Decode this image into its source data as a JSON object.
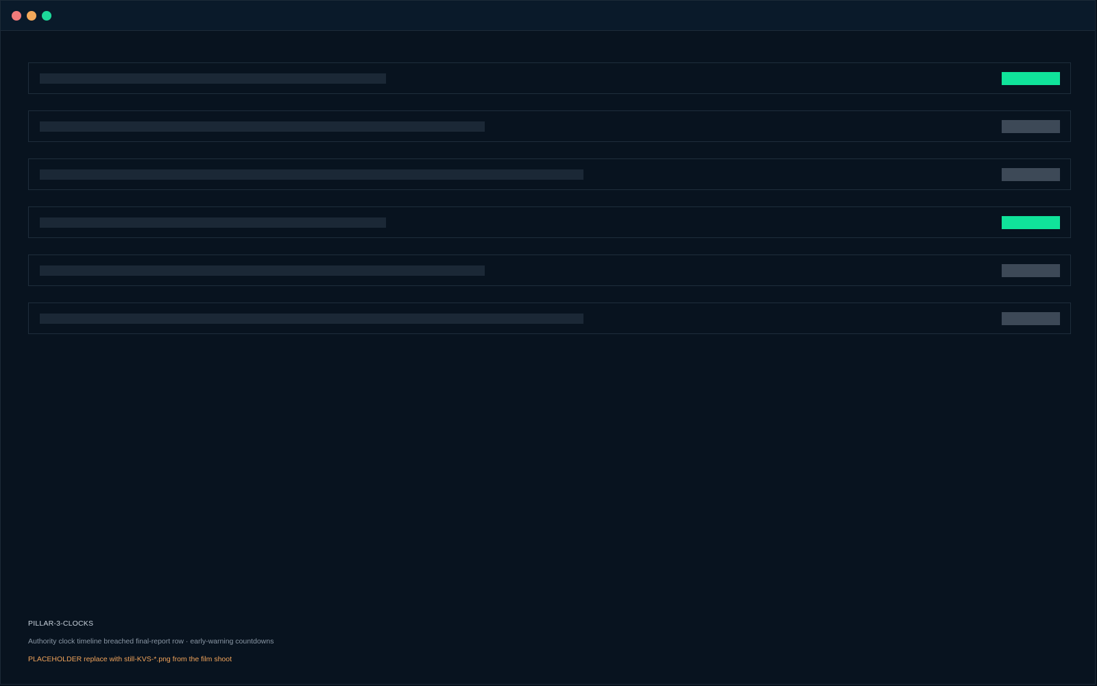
{
  "window": {
    "controls": [
      {
        "name": "close",
        "color": "#f27b7b"
      },
      {
        "name": "minimize",
        "color": "#f4a95a"
      },
      {
        "name": "maximize",
        "color": "#1dd99a"
      }
    ]
  },
  "rows": [
    {
      "badge_color": "#10e39a"
    },
    {
      "badge_color": "#3d4957"
    },
    {
      "badge_color": "#3d4957"
    },
    {
      "badge_color": "#10e39a"
    },
    {
      "badge_color": "#3d4957"
    },
    {
      "badge_color": "#3d4957"
    }
  ],
  "caption": {
    "title": "PILLAR-3-CLOCKS",
    "subtitle": "Authority clock timeline  breached final-report row · early-warning countdowns",
    "note": "PLACEHOLDER replace with still-KVS-*.png from the film shoot"
  }
}
